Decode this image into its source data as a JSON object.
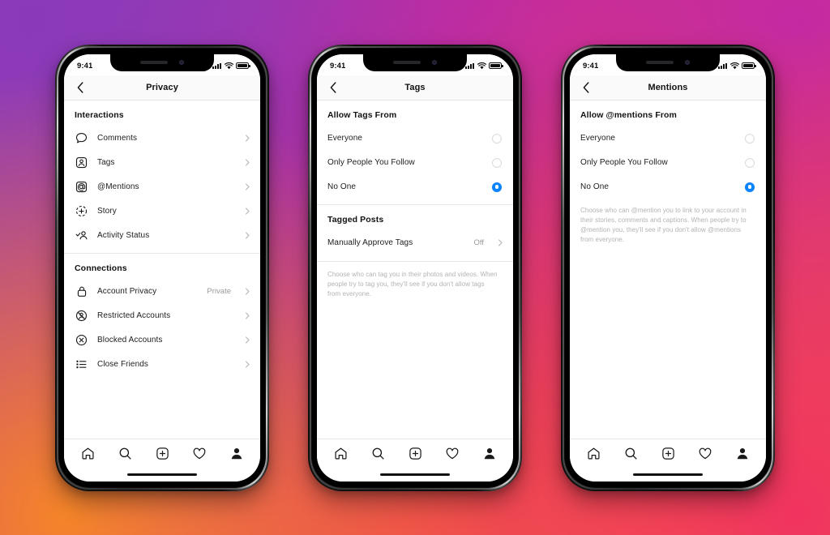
{
  "background": {
    "gradient_colors": [
      "#8a3ab9",
      "#c32aa3",
      "#f0335f",
      "#f58529"
    ]
  },
  "accent_color": "#0a84ff",
  "status_bar": {
    "time": "9:41",
    "signal_icon": "cellular-signal-icon",
    "wifi_icon": "wifi-icon",
    "battery_icon": "battery-icon"
  },
  "tab_bar": {
    "items": [
      {
        "name": "home",
        "icon": "home-icon"
      },
      {
        "name": "search",
        "icon": "search-icon"
      },
      {
        "name": "create",
        "icon": "plus-square-icon"
      },
      {
        "name": "activity",
        "icon": "heart-icon"
      },
      {
        "name": "profile",
        "icon": "person-filled-icon"
      }
    ]
  },
  "screens": [
    {
      "id": "privacy",
      "nav": {
        "back_icon": "chevron-left-icon",
        "title": "Privacy"
      },
      "sections": [
        {
          "heading": "Interactions",
          "rows": [
            {
              "label": "Comments",
              "icon": "comment-bubble-icon",
              "value": "",
              "chevron": "chevron-right-icon"
            },
            {
              "label": "Tags",
              "icon": "tag-person-icon",
              "value": "",
              "chevron": "chevron-right-icon"
            },
            {
              "label": "@Mentions",
              "icon": "at-mention-icon",
              "value": "",
              "chevron": "chevron-right-icon"
            },
            {
              "label": "Story",
              "icon": "story-plus-icon",
              "value": "",
              "chevron": "chevron-right-icon"
            },
            {
              "label": "Activity Status",
              "icon": "activity-status-icon",
              "value": "",
              "chevron": "chevron-right-icon"
            }
          ]
        },
        {
          "heading": "Connections",
          "rows": [
            {
              "label": "Account Privacy",
              "icon": "lock-icon",
              "value": "Private",
              "chevron": "chevron-right-icon"
            },
            {
              "label": "Restricted Accounts",
              "icon": "restricted-icon",
              "value": "",
              "chevron": "chevron-right-icon"
            },
            {
              "label": "Blocked Accounts",
              "icon": "blocked-circle-x-icon",
              "value": "",
              "chevron": "chevron-right-icon"
            },
            {
              "label": "Close Friends",
              "icon": "close-friends-list-icon",
              "value": "",
              "chevron": "chevron-right-icon"
            }
          ]
        }
      ]
    },
    {
      "id": "tags",
      "nav": {
        "back_icon": "chevron-left-icon",
        "title": "Tags"
      },
      "group_heading": "Allow Tags From",
      "options": [
        {
          "label": "Everyone",
          "selected": false
        },
        {
          "label": "Only People You Follow",
          "selected": false
        },
        {
          "label": "No One",
          "selected": true
        }
      ],
      "second_heading": "Tagged Posts",
      "second_rows": [
        {
          "label": "Manually Approve Tags",
          "value": "Off",
          "chevron": "chevron-right-icon"
        }
      ],
      "footnote": "Choose who can tag you in their photos and videos. When people try to tag you, they'll see if you don't allow tags from everyone."
    },
    {
      "id": "mentions",
      "nav": {
        "back_icon": "chevron-left-icon",
        "title": "Mentions"
      },
      "group_heading": "Allow @mentions From",
      "options": [
        {
          "label": "Everyone",
          "selected": false
        },
        {
          "label": "Only People You Follow",
          "selected": false
        },
        {
          "label": "No One",
          "selected": true
        }
      ],
      "footnote": "Choose who can @mention you to link to your account in their stories, comments and captions. When people try to @mention you, they'll see if you don't allow @mentions from everyone."
    }
  ]
}
